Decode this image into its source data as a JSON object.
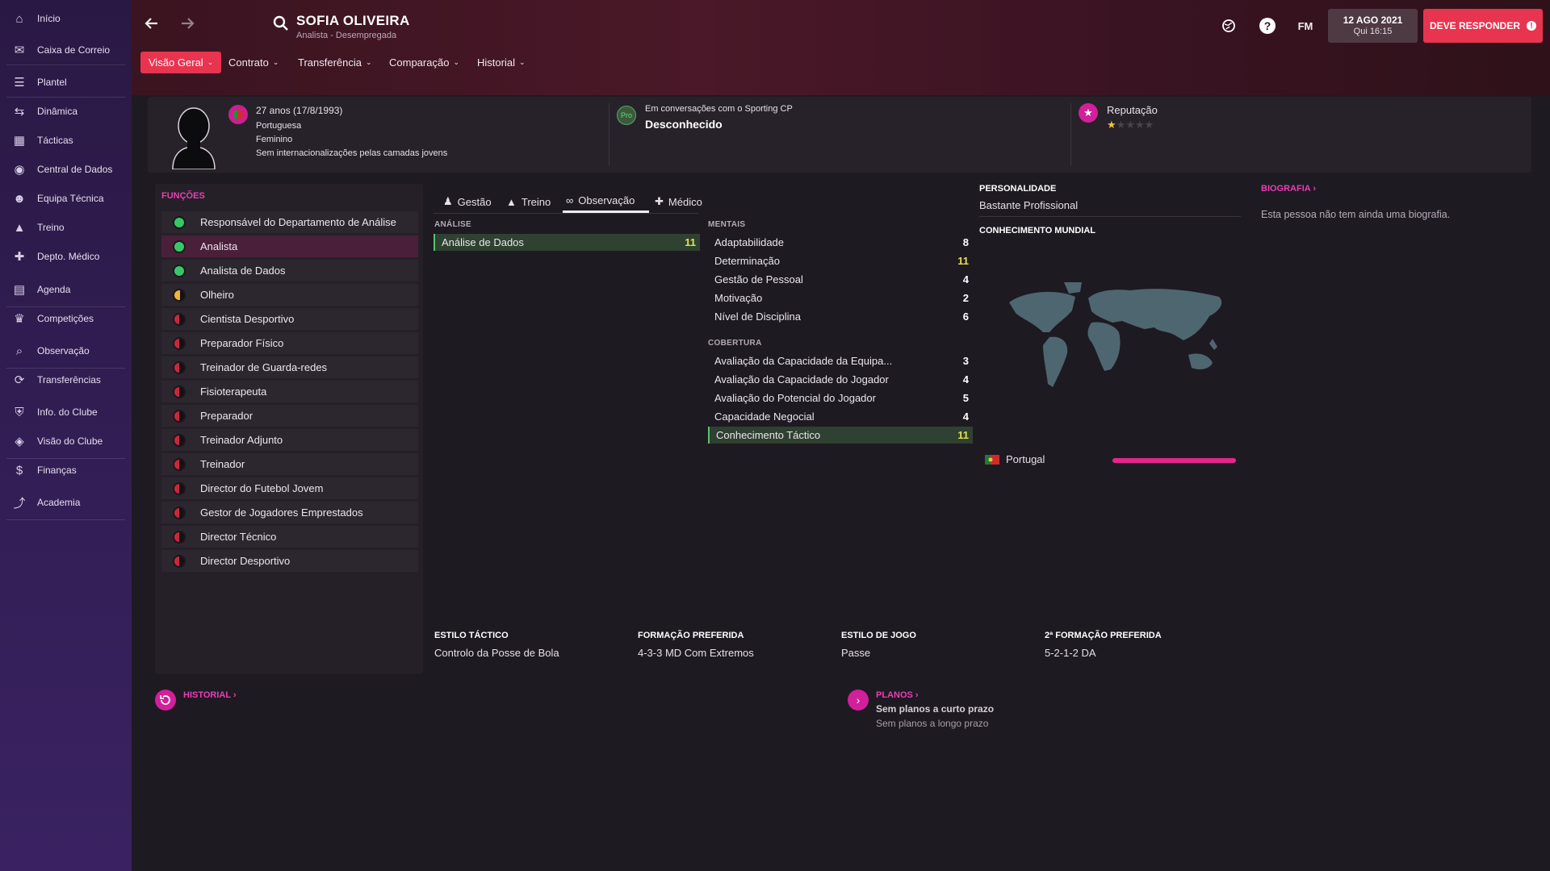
{
  "sidebar": {
    "items": [
      {
        "label": "Início",
        "icon": "home-icon"
      },
      {
        "label": "Caixa de Correio",
        "icon": "inbox-icon"
      },
      {
        "label": "Plantel",
        "icon": "squad-icon"
      },
      {
        "label": "Dinâmica",
        "icon": "dynamics-icon"
      },
      {
        "label": "Tácticas",
        "icon": "tactics-icon"
      },
      {
        "label": "Central de Dados",
        "icon": "data-hub-icon"
      },
      {
        "label": "Equipa Técnica",
        "icon": "staff-icon"
      },
      {
        "label": "Treino",
        "icon": "training-icon"
      },
      {
        "label": "Depto. Médico",
        "icon": "medical-icon"
      },
      {
        "label": "Agenda",
        "icon": "calendar-icon"
      },
      {
        "label": "Competições",
        "icon": "trophy-icon"
      },
      {
        "label": "Observação",
        "icon": "scouting-icon"
      },
      {
        "label": "Transferências",
        "icon": "transfers-icon"
      },
      {
        "label": "Info. do Clube",
        "icon": "club-info-icon"
      },
      {
        "label": "Visão do Clube",
        "icon": "club-vision-icon"
      },
      {
        "label": "Finanças",
        "icon": "finances-icon"
      },
      {
        "label": "Academia",
        "icon": "academy-icon"
      }
    ]
  },
  "header": {
    "name": "SOFIA OLIVEIRA",
    "subtitle": "Analista - Desempregada",
    "fm_label": "FM",
    "date_main": "12 AGO 2021",
    "date_sub": "Qui 16:15",
    "respond_label": "DEVE RESPONDER",
    "alert_symbol": "!"
  },
  "menu": {
    "tabs": [
      "Visão Geral",
      "Contrato",
      "Transferência",
      "Comparação",
      "Historial"
    ]
  },
  "info": {
    "age": "27 anos (17/8/1993)",
    "nationality": "Portuguesa",
    "gender": "Feminino",
    "international": "Sem internacionalizações pelas camadas jovens",
    "talks_label": "Em conversações com o Sporting CP",
    "talks_badge": "Pro",
    "talks_value": "Desconhecido",
    "reputation_label": "Reputação",
    "reputation_stars": 1,
    "reputation_max": 5
  },
  "roles": {
    "title": "FUNÇÕES",
    "items": [
      {
        "label": "Responsável do Departamento de Análise",
        "status": "green"
      },
      {
        "label": "Analista",
        "status": "green",
        "selected": true
      },
      {
        "label": "Analista de Dados",
        "status": "green"
      },
      {
        "label": "Olheiro",
        "status": "amber"
      },
      {
        "label": "Cientista Desportivo",
        "status": "red"
      },
      {
        "label": "Preparador Físico",
        "status": "red"
      },
      {
        "label": "Treinador de Guarda-redes",
        "status": "red"
      },
      {
        "label": "Fisioterapeuta",
        "status": "red"
      },
      {
        "label": "Preparador",
        "status": "red"
      },
      {
        "label": "Treinador Adjunto",
        "status": "red"
      },
      {
        "label": "Treinador",
        "status": "red"
      },
      {
        "label": "Director do Futebol Jovem",
        "status": "red"
      },
      {
        "label": "Gestor de Jogadores Emprestados",
        "status": "red"
      },
      {
        "label": "Director Técnico",
        "status": "red"
      },
      {
        "label": "Director Desportivo",
        "status": "red"
      }
    ],
    "colors": {
      "green": "#38c766",
      "amber": "#f0b43a",
      "red": "#c8283c"
    }
  },
  "subtabs": [
    "Gestão",
    "Treino",
    "Observação",
    "Médico"
  ],
  "analysis": {
    "label": "ANÁLISE",
    "items": [
      {
        "name": "Análise de Dados",
        "value": "11"
      }
    ]
  },
  "mentals": {
    "label": "MENTAIS",
    "items": [
      {
        "name": "Adaptabilidade",
        "value": "8"
      },
      {
        "name": "Determinação",
        "value": "11"
      },
      {
        "name": "Gestão de Pessoal",
        "value": "4"
      },
      {
        "name": "Motivação",
        "value": "2"
      },
      {
        "name": "Nível de Disciplina",
        "value": "6"
      }
    ]
  },
  "coverage": {
    "label": "COBERTURA",
    "items": [
      {
        "name": "Avaliação da Capacidade da Equipa...",
        "value": "3"
      },
      {
        "name": "Avaliação da Capacidade do Jogador",
        "value": "4"
      },
      {
        "name": "Avaliação do Potencial do Jogador",
        "value": "5"
      },
      {
        "name": "Capacidade Negocial",
        "value": "4"
      },
      {
        "name": "Conhecimento Táctico",
        "value": "11"
      }
    ]
  },
  "personality": {
    "label": "PERSONALIDADE",
    "value": "Bastante Profissional"
  },
  "world": {
    "label": "CONHECIMENTO MUNDIAL",
    "country": "Portugal",
    "knowledge": 1.0,
    "bar_color": "#e6258f"
  },
  "biography": {
    "label": "BIOGRAFIA",
    "text": "Esta pessoa não tem ainda uma biografia."
  },
  "tactics": {
    "style_label": "ESTILO TÁCTICO",
    "style_value": "Controlo da Posse de Bola",
    "formation_label": "FORMAÇÃO PREFERIDA",
    "formation_value": "4-3-3 MD Com Extremos",
    "play_label": "ESTILO DE JOGO",
    "play_value": "Passe",
    "formation2_label": "2ª FORMAÇÃO PREFERIDA",
    "formation2_value": "5-2-1-2 DA"
  },
  "history": {
    "label": "HISTORIAL"
  },
  "plans": {
    "label": "PLANOS",
    "short": "Sem planos a curto prazo",
    "long": "Sem planos a longo prazo"
  }
}
